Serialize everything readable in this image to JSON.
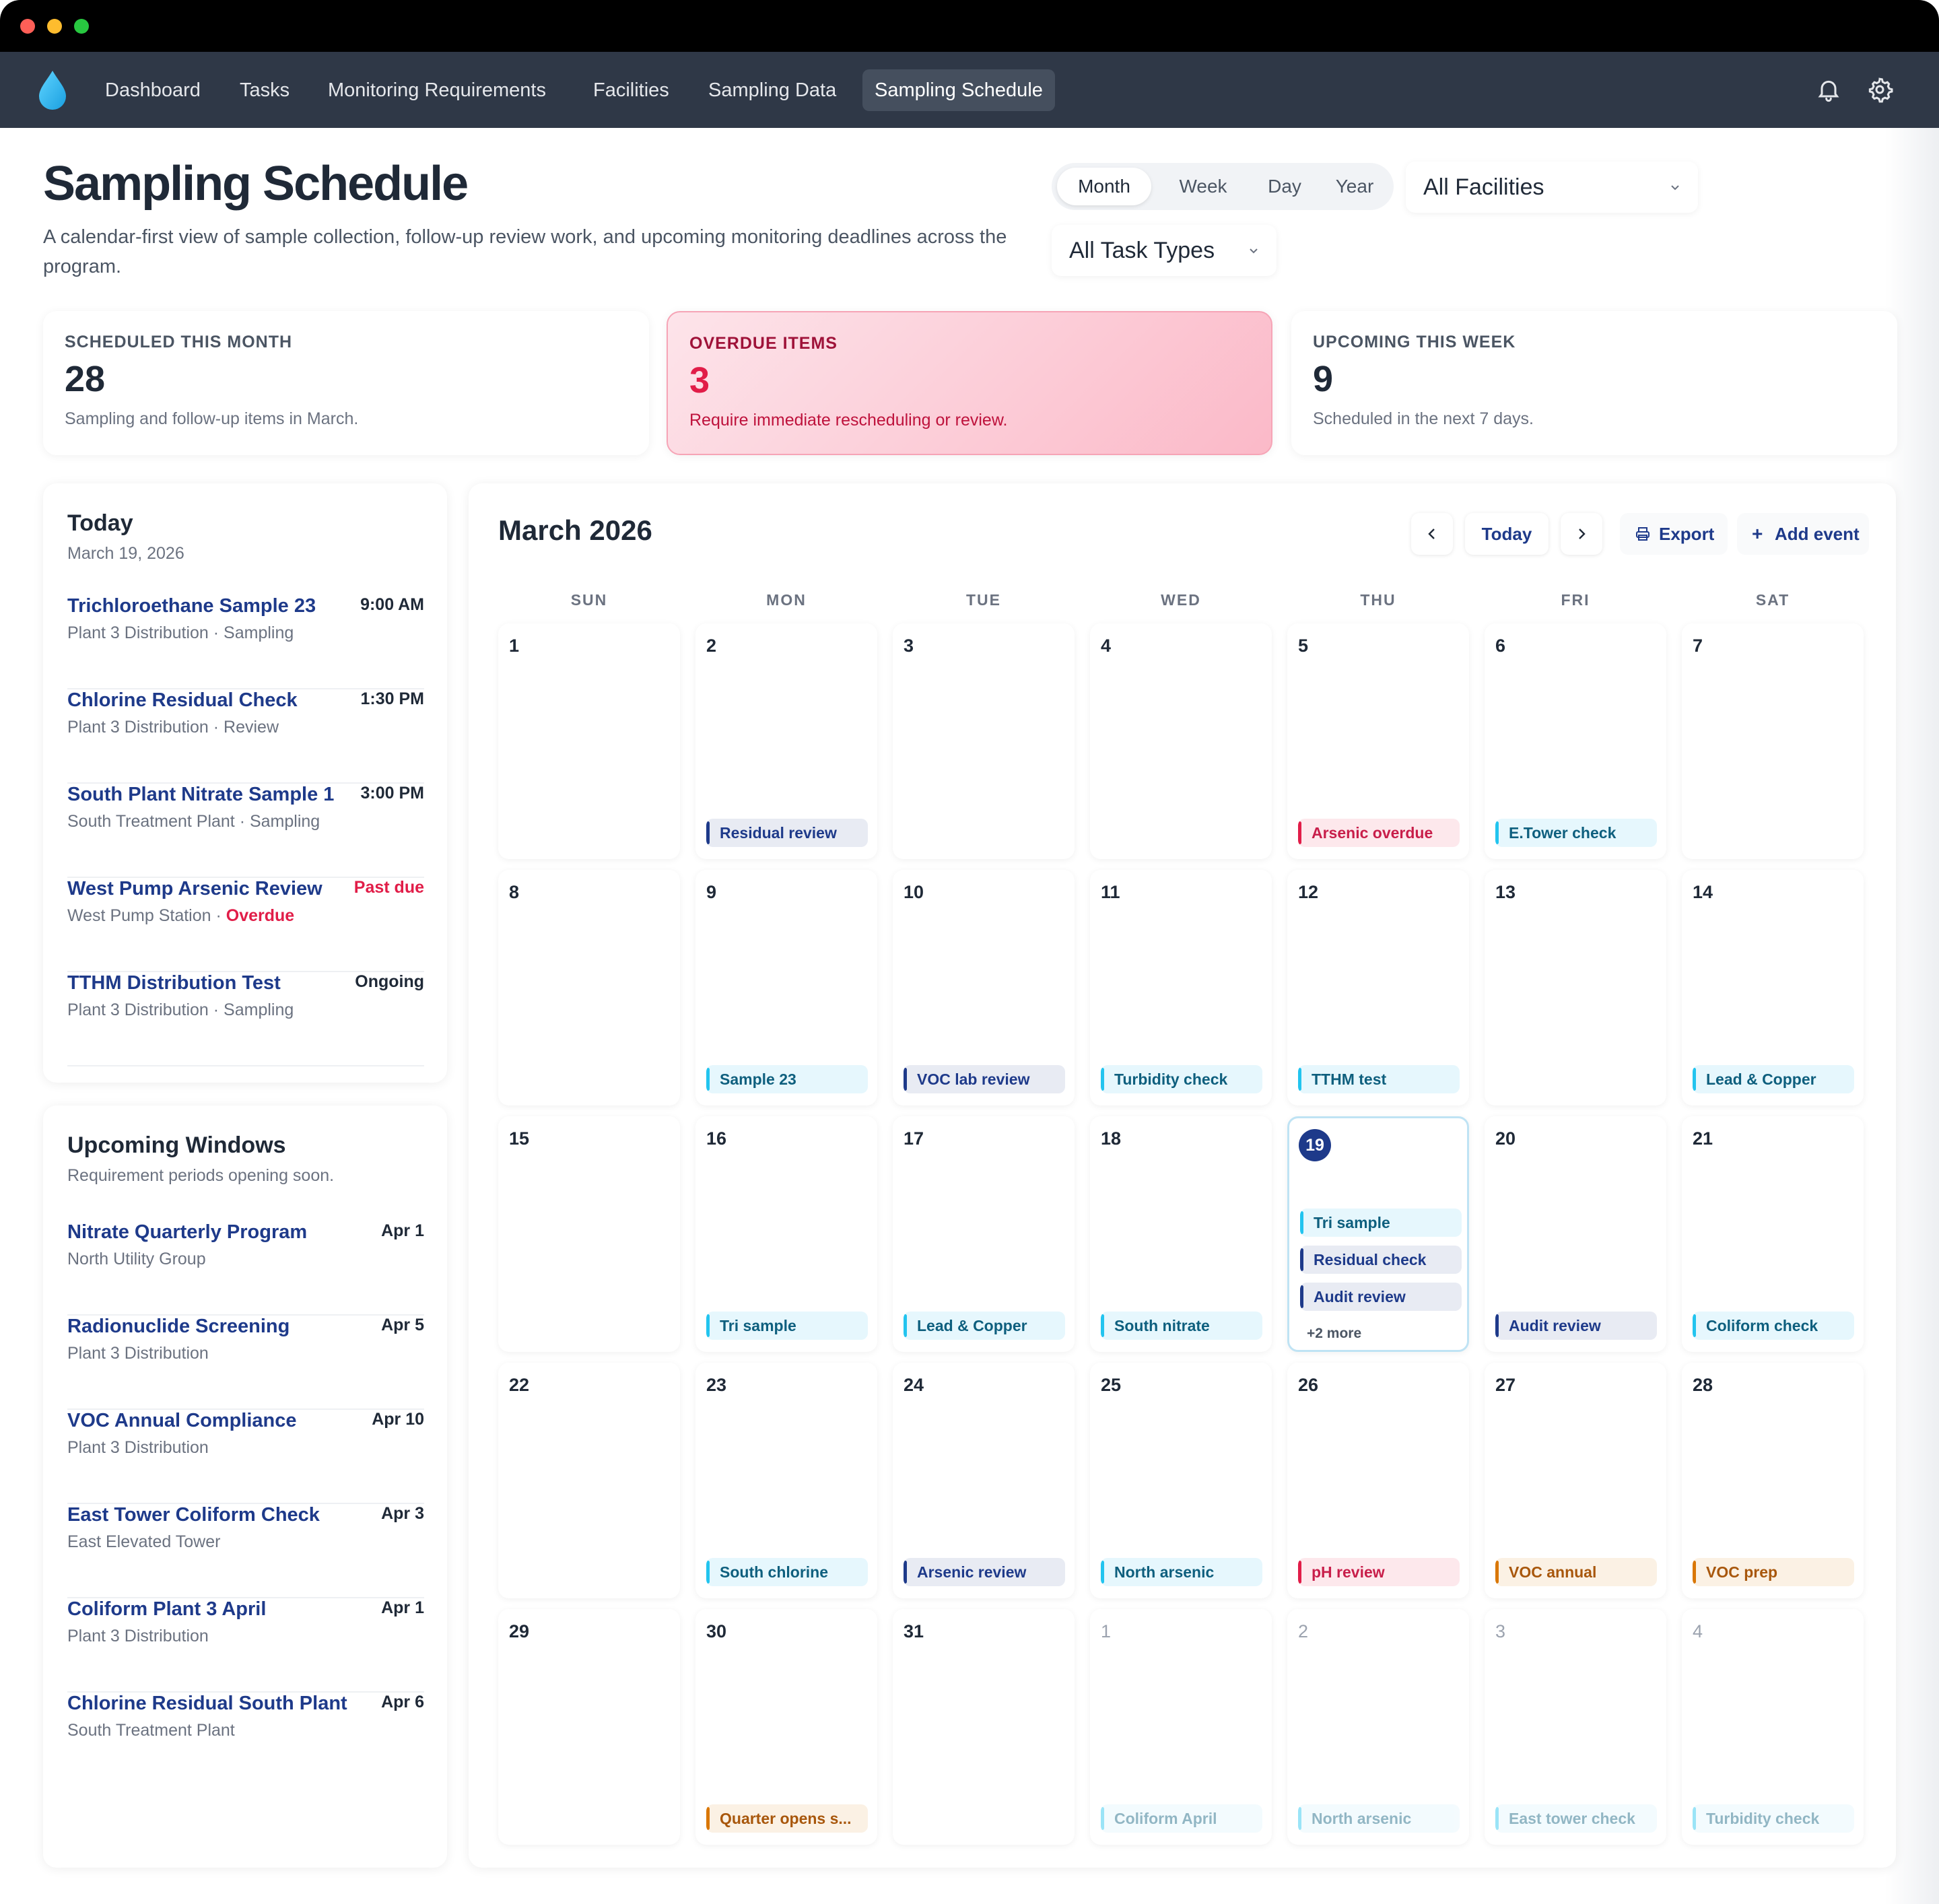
{
  "nav": {
    "items": [
      "Dashboard",
      "Tasks",
      "Monitoring Requirements",
      "Facilities",
      "Sampling Data",
      "Sampling Schedule"
    ],
    "active": "Sampling Schedule"
  },
  "header": {
    "title": "Sampling Schedule",
    "subtitle": "A calendar-first view of sample collection, follow-up review work, and upcoming monitoring deadlines across the program."
  },
  "view_toggle": {
    "options": [
      "Month",
      "Week",
      "Day",
      "Year"
    ],
    "selected": "Month"
  },
  "filters": {
    "facility": "All Facilities",
    "task_type": "All Task Types"
  },
  "stats": [
    {
      "label": "SCHEDULED THIS MONTH",
      "value": "28",
      "desc": "Sampling and follow-up items in March."
    },
    {
      "label": "OVERDUE ITEMS",
      "value": "3",
      "desc": "Require immediate rescheduling or review."
    },
    {
      "label": "UPCOMING THIS WEEK",
      "value": "9",
      "desc": "Scheduled in the next 7 days."
    }
  ],
  "today": {
    "title": "Today",
    "date": "March 19, 2026",
    "items": [
      {
        "title": "Trichloroethane Sample 23",
        "sub": "Plant 3 Distribution · Sampling",
        "time": "9:00 AM"
      },
      {
        "title": "Chlorine Residual Check",
        "sub": "Plant 3 Distribution · Review",
        "time": "1:30 PM"
      },
      {
        "title": "South Plant Nitrate Sample 1",
        "sub": "South Treatment Plant · Sampling",
        "time": "3:00 PM"
      },
      {
        "title": "West Pump Arsenic Review",
        "sub": "West Pump Station · ",
        "sub_flag": "Overdue",
        "time": "Past due"
      },
      {
        "title": "TTHM Distribution Test",
        "sub": "Plant 3 Distribution · Sampling",
        "time": "Ongoing"
      }
    ]
  },
  "upcoming": {
    "title": "Upcoming Windows",
    "subtitle": "Requirement periods opening soon.",
    "items": [
      {
        "title": "Nitrate Quarterly Program",
        "sub": "North Utility Group",
        "date": "Apr 1"
      },
      {
        "title": "Radionuclide Screening",
        "sub": "Plant 3 Distribution",
        "date": "Apr 5"
      },
      {
        "title": "VOC Annual Compliance",
        "sub": "Plant 3 Distribution",
        "date": "Apr 10"
      },
      {
        "title": "East Tower Coliform Check",
        "sub": "East Elevated Tower",
        "date": "Apr 3"
      },
      {
        "title": "Coliform Plant 3 April",
        "sub": "Plant 3 Distribution",
        "date": "Apr 1"
      },
      {
        "title": "Chlorine Residual South Plant",
        "sub": "South Treatment Plant",
        "date": "Apr 6"
      }
    ]
  },
  "calendar": {
    "title": "March 2026",
    "today_label": "Today",
    "export_label": "Export",
    "add_label": "Add event",
    "weekdays": [
      "SUN",
      "MON",
      "TUE",
      "WED",
      "THU",
      "FRI",
      "SAT"
    ],
    "more_label": "+2 more",
    "days": [
      {
        "n": "1",
        "events": []
      },
      {
        "n": "2",
        "events": [
          {
            "t": "Residual review",
            "c": "navy"
          }
        ]
      },
      {
        "n": "3",
        "events": []
      },
      {
        "n": "4",
        "events": []
      },
      {
        "n": "5",
        "events": [
          {
            "t": "Arsenic overdue",
            "c": "red"
          }
        ]
      },
      {
        "n": "6",
        "events": [
          {
            "t": "E.Tower check",
            "c": "cyan"
          }
        ]
      },
      {
        "n": "7",
        "events": []
      },
      {
        "n": "8",
        "events": []
      },
      {
        "n": "9",
        "events": [
          {
            "t": "Sample 23",
            "c": "cyan"
          }
        ]
      },
      {
        "n": "10",
        "events": [
          {
            "t": "VOC lab review",
            "c": "navy"
          }
        ]
      },
      {
        "n": "11",
        "events": [
          {
            "t": "Turbidity check",
            "c": "cyan"
          }
        ]
      },
      {
        "n": "12",
        "events": [
          {
            "t": "TTHM test",
            "c": "cyan"
          }
        ]
      },
      {
        "n": "13",
        "events": []
      },
      {
        "n": "14",
        "events": [
          {
            "t": "Lead & Copper",
            "c": "cyan"
          }
        ]
      },
      {
        "n": "15",
        "events": []
      },
      {
        "n": "16",
        "events": [
          {
            "t": "Tri sample",
            "c": "cyan"
          }
        ]
      },
      {
        "n": "17",
        "events": [
          {
            "t": "Lead & Copper",
            "c": "cyan"
          }
        ]
      },
      {
        "n": "18",
        "events": [
          {
            "t": "South nitrate",
            "c": "cyan"
          }
        ]
      },
      {
        "n": "19",
        "today": true,
        "events": [
          {
            "t": "Tri sample",
            "c": "cyan"
          },
          {
            "t": "Residual check",
            "c": "navy"
          },
          {
            "t": "Audit review",
            "c": "navy"
          }
        ]
      },
      {
        "n": "20",
        "events": [
          {
            "t": "Audit review",
            "c": "navy"
          }
        ]
      },
      {
        "n": "21",
        "events": [
          {
            "t": "Coliform check",
            "c": "cyan"
          }
        ]
      },
      {
        "n": "22",
        "events": []
      },
      {
        "n": "23",
        "events": [
          {
            "t": "South chlorine",
            "c": "cyan"
          }
        ]
      },
      {
        "n": "24",
        "events": [
          {
            "t": "Arsenic review",
            "c": "navy"
          }
        ]
      },
      {
        "n": "25",
        "events": [
          {
            "t": "North arsenic",
            "c": "cyan"
          }
        ]
      },
      {
        "n": "26",
        "events": [
          {
            "t": "pH review",
            "c": "red"
          }
        ]
      },
      {
        "n": "27",
        "events": [
          {
            "t": "VOC annual",
            "c": "amber"
          }
        ]
      },
      {
        "n": "28",
        "events": [
          {
            "t": "VOC prep",
            "c": "amber"
          }
        ]
      },
      {
        "n": "29",
        "events": []
      },
      {
        "n": "30",
        "events": [
          {
            "t": "Quarter opens s...",
            "c": "amber"
          }
        ]
      },
      {
        "n": "31",
        "events": []
      },
      {
        "n": "1",
        "other": true,
        "events": [
          {
            "t": "Coliform April",
            "c": "cyan"
          }
        ]
      },
      {
        "n": "2",
        "other": true,
        "events": [
          {
            "t": "North arsenic",
            "c": "cyan"
          }
        ]
      },
      {
        "n": "3",
        "other": true,
        "events": [
          {
            "t": "East tower check",
            "c": "cyan"
          }
        ]
      },
      {
        "n": "4",
        "other": true,
        "events": [
          {
            "t": "Turbidity check",
            "c": "cyan"
          }
        ]
      }
    ]
  }
}
